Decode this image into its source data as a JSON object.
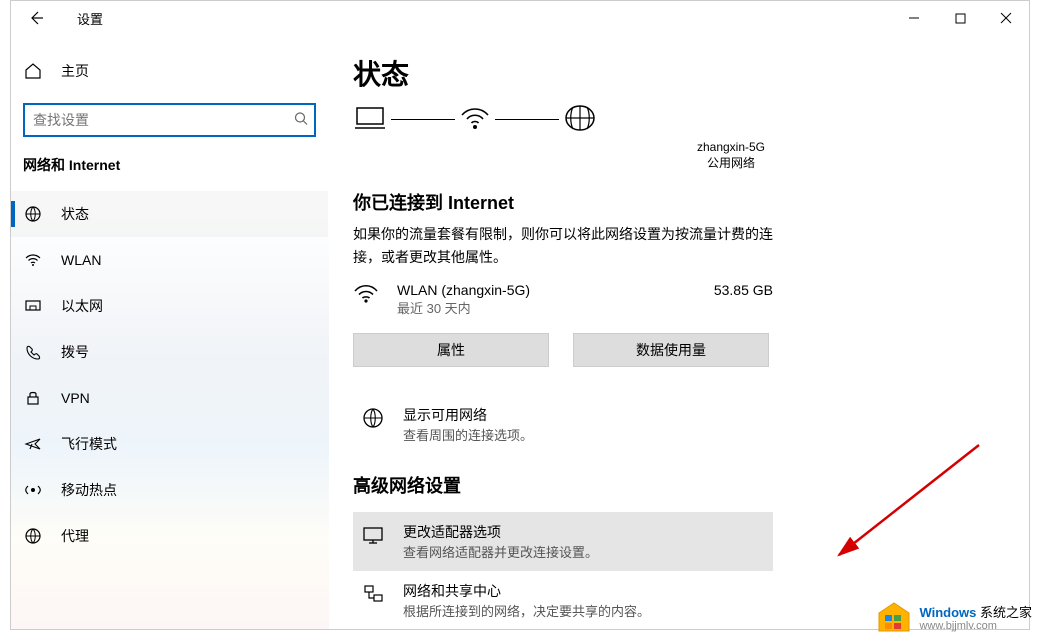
{
  "window": {
    "title": "设置"
  },
  "sidebar": {
    "home": "主页",
    "search_placeholder": "查找设置",
    "section_title": "网络和 Internet",
    "items": [
      {
        "label": "状态",
        "icon": "status-icon",
        "active": true
      },
      {
        "label": "WLAN",
        "icon": "wifi-icon"
      },
      {
        "label": "以太网",
        "icon": "ethernet-icon"
      },
      {
        "label": "拨号",
        "icon": "dialup-icon"
      },
      {
        "label": "VPN",
        "icon": "vpn-icon"
      },
      {
        "label": "飞行模式",
        "icon": "airplane-icon"
      },
      {
        "label": "移动热点",
        "icon": "hotspot-icon"
      },
      {
        "label": "代理",
        "icon": "proxy-icon"
      }
    ]
  },
  "main": {
    "page_title": "状态",
    "diagram": {
      "network_name": "zhangxin-5G",
      "network_type": "公用网络"
    },
    "connected_heading": "你已连接到 Internet",
    "connected_desc": "如果你的流量套餐有限制，则你可以将此网络设置为按流量计费的连接，或者更改其他属性。",
    "conn": {
      "name": "WLAN (zhangxin-5G)",
      "period": "最近 30 天内",
      "usage": "53.85 GB"
    },
    "buttons": {
      "properties": "属性",
      "data_usage": "数据使用量"
    },
    "links": {
      "show_networks": {
        "title": "显示可用网络",
        "sub": "查看周围的连接选项。"
      },
      "adapter_options": {
        "title": "更改适配器选项",
        "sub": "查看网络适配器并更改连接设置。"
      },
      "sharing_center": {
        "title": "网络和共享中心",
        "sub": "根据所连接到的网络，决定要共享的内容。"
      }
    },
    "advanced_heading": "高级网络设置"
  },
  "watermark": {
    "brand_prefix": "Windows",
    "brand_suffix": " 系统之家",
    "url": "www.bjjmlv.com"
  }
}
